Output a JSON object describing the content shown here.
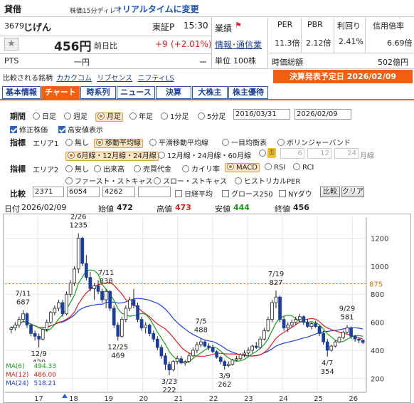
{
  "header": {
    "category": "貸借",
    "delay_note": "株価15分ディレイ",
    "arrow": "→",
    "realtime_link": "リアルタイムに変更"
  },
  "quote": {
    "code": "3679",
    "name": "じげん",
    "market": "東証P",
    "time": "15:30",
    "price": "456円",
    "prev_label": "前日比",
    "change": "+9",
    "change_pct": "(+2.01%)",
    "pts_label": "PTS",
    "pts_value": "一円",
    "pts_change": "ー"
  },
  "sector": {
    "label": "業績",
    "link": "情報･通信業",
    "unit_label": "単位",
    "unit_value": "100株"
  },
  "metrics": {
    "headers": [
      "PER",
      "PBR",
      "利回り",
      "信用倍率"
    ],
    "values": [
      "11.3倍",
      "2.12倍",
      "2.41%",
      "6.69倍"
    ],
    "mcap_label": "時価総額",
    "mcap_value": "502億円"
  },
  "compare_line": {
    "label": "比較される銘柄",
    "links": [
      "カカクコム",
      "リブセンス",
      "ニフティLS"
    ]
  },
  "earnings": "決算発表予定日 2026/02/09",
  "tabs": [
    "基本情報",
    "チャート",
    "時系列",
    "ニュース",
    "決算",
    "大株主",
    "株主優待"
  ],
  "controls": {
    "period_label": "期間",
    "periods": [
      "日足",
      "週足",
      "月足",
      "年足",
      "1分足",
      "5分足"
    ],
    "date_from": "2016/03/31",
    "date_to": "2026/02/09",
    "adj_label": "修正株価",
    "hilo_label": "高安値表示",
    "ind_label": "指標",
    "area1": "エリア1",
    "area1_opts": [
      "無し",
      "移動平均線",
      "平滑移動平均線",
      "一目均衡表",
      "ボリンジャーバンド"
    ],
    "ma_opts": [
      "6月線・12月線・24月線",
      "12月線・24月線・60月線"
    ],
    "ma_custom": [
      "6",
      "12",
      "24"
    ],
    "ma_unit": "月線",
    "area2": "エリア2",
    "area2_row1": [
      "無し",
      "出来高",
      "売買代金",
      "カイリ率",
      "MACD",
      "RSI",
      "RCI"
    ],
    "area2_row2": [
      "ファースト・ストキャス",
      "スロー・ストキャス",
      "ヒストリカルPER"
    ],
    "cmp_label": "比較",
    "cmp_codes": [
      "2371",
      "6054",
      "4262",
      ""
    ],
    "cmp_opts": [
      "日経平均",
      "グロース250",
      "NYダウ"
    ],
    "cmp_btn": "比較",
    "clear_btn": "クリア"
  },
  "ohlc": {
    "date_label": "日付",
    "date": "2026/02/09",
    "open_label": "始値",
    "open": "472",
    "high_label": "高値",
    "high": "473",
    "low_label": "安値",
    "low": "444",
    "close_label": "終値",
    "close": "456"
  },
  "colors": {
    "accent": "#f2600f",
    "ma6": "#1aa01a",
    "ma12": "#e02020",
    "ma24": "#2040e0",
    "candle_up": "#ffffff",
    "candle_down": "#1a3fa0"
  },
  "chart_data": {
    "type": "candlestick",
    "ylim": [
      100,
      1350
    ],
    "yticks": [
      "200",
      "400",
      "600",
      "800",
      "1000",
      "1200"
    ],
    "current_price": "875",
    "xticks": [
      "17",
      "18",
      "19",
      "20",
      "21",
      "22",
      "23",
      "24",
      "25",
      "26"
    ],
    "annotations": [
      {
        "date": "7/11",
        "value": "687"
      },
      {
        "date": "12/9",
        "value": "420"
      },
      {
        "date": "2/26",
        "value": "1235"
      },
      {
        "date": "7/11",
        "value": "838"
      },
      {
        "date": "12/25",
        "value": "469"
      },
      {
        "date": "3/23",
        "value": "222"
      },
      {
        "date": "7/5",
        "value": "488"
      },
      {
        "date": "3/9",
        "value": "262"
      },
      {
        "date": "7/19",
        "value": "827"
      },
      {
        "date": "4/7",
        "value": "354"
      },
      {
        "date": "9/29",
        "value": "581"
      }
    ],
    "ma_legend": [
      {
        "name": "MA(6)",
        "value": "494.33"
      },
      {
        "name": "MA(12)",
        "value": "486.00"
      },
      {
        "name": "MA(24)",
        "value": "518.21"
      }
    ],
    "candles": [
      [
        550,
        570,
        520,
        560
      ],
      [
        560,
        600,
        540,
        580
      ],
      [
        580,
        640,
        560,
        620
      ],
      [
        620,
        687,
        600,
        660
      ],
      [
        660,
        670,
        560,
        580
      ],
      [
        580,
        590,
        500,
        520
      ],
      [
        520,
        540,
        470,
        500
      ],
      [
        500,
        520,
        420,
        480
      ],
      [
        480,
        560,
        470,
        550
      ],
      [
        550,
        620,
        530,
        600
      ],
      [
        600,
        680,
        590,
        670
      ],
      [
        670,
        720,
        650,
        700
      ],
      [
        700,
        760,
        680,
        740
      ],
      [
        740,
        760,
        640,
        660
      ],
      [
        660,
        820,
        650,
        800
      ],
      [
        800,
        900,
        780,
        880
      ],
      [
        880,
        1000,
        860,
        980
      ],
      [
        980,
        1235,
        950,
        1200
      ],
      [
        1200,
        1210,
        1000,
        1020
      ],
      [
        1020,
        1080,
        900,
        920
      ],
      [
        920,
        960,
        820,
        840
      ],
      [
        840,
        880,
        760,
        860
      ],
      [
        860,
        900,
        800,
        820
      ],
      [
        820,
        840,
        740,
        760
      ],
      [
        760,
        838,
        700,
        820
      ],
      [
        820,
        830,
        680,
        700
      ],
      [
        700,
        720,
        560,
        580
      ],
      [
        580,
        600,
        469,
        500
      ],
      [
        500,
        640,
        490,
        620
      ],
      [
        620,
        720,
        600,
        700
      ],
      [
        700,
        780,
        680,
        760
      ],
      [
        760,
        838,
        700,
        720
      ],
      [
        720,
        740,
        600,
        620
      ],
      [
        620,
        640,
        540,
        560
      ],
      [
        560,
        600,
        520,
        580
      ],
      [
        580,
        590,
        500,
        520
      ],
      [
        520,
        540,
        460,
        480
      ],
      [
        480,
        500,
        400,
        420
      ],
      [
        420,
        440,
        340,
        360
      ],
      [
        360,
        380,
        260,
        300
      ],
      [
        300,
        320,
        222,
        260
      ],
      [
        260,
        330,
        250,
        320
      ],
      [
        320,
        360,
        300,
        340
      ],
      [
        340,
        360,
        300,
        310
      ],
      [
        310,
        330,
        290,
        320
      ],
      [
        320,
        380,
        310,
        360
      ],
      [
        360,
        420,
        350,
        400
      ],
      [
        400,
        460,
        380,
        440
      ],
      [
        440,
        488,
        420,
        460
      ],
      [
        460,
        470,
        420,
        430
      ],
      [
        430,
        450,
        400,
        420
      ],
      [
        420,
        440,
        380,
        390
      ],
      [
        390,
        400,
        340,
        350
      ],
      [
        350,
        360,
        300,
        320
      ],
      [
        320,
        330,
        262,
        290
      ],
      [
        290,
        320,
        280,
        300
      ],
      [
        300,
        340,
        290,
        330
      ],
      [
        330,
        360,
        320,
        340
      ],
      [
        340,
        380,
        330,
        370
      ],
      [
        370,
        400,
        350,
        380
      ],
      [
        380,
        420,
        360,
        400
      ],
      [
        400,
        440,
        380,
        430
      ],
      [
        430,
        460,
        410,
        420
      ],
      [
        420,
        500,
        410,
        480
      ],
      [
        480,
        560,
        470,
        540
      ],
      [
        540,
        640,
        530,
        620
      ],
      [
        620,
        760,
        600,
        740
      ],
      [
        740,
        827,
        700,
        780
      ],
      [
        780,
        790,
        600,
        620
      ],
      [
        620,
        640,
        540,
        560
      ],
      [
        560,
        600,
        530,
        580
      ],
      [
        580,
        620,
        560,
        600
      ],
      [
        600,
        640,
        580,
        620
      ],
      [
        620,
        660,
        600,
        640
      ],
      [
        640,
        650,
        580,
        600
      ],
      [
        600,
        620,
        560,
        570
      ],
      [
        570,
        600,
        550,
        590
      ],
      [
        590,
        610,
        560,
        570
      ],
      [
        570,
        580,
        500,
        520
      ],
      [
        520,
        540,
        440,
        460
      ],
      [
        460,
        480,
        354,
        400
      ],
      [
        400,
        440,
        390,
        430
      ],
      [
        430,
        470,
        420,
        460
      ],
      [
        460,
        500,
        450,
        490
      ],
      [
        490,
        540,
        480,
        530
      ],
      [
        530,
        581,
        520,
        560
      ],
      [
        560,
        570,
        480,
        500
      ],
      [
        500,
        510,
        460,
        480
      ],
      [
        480,
        490,
        450,
        472
      ],
      [
        472,
        473,
        444,
        456
      ]
    ]
  }
}
